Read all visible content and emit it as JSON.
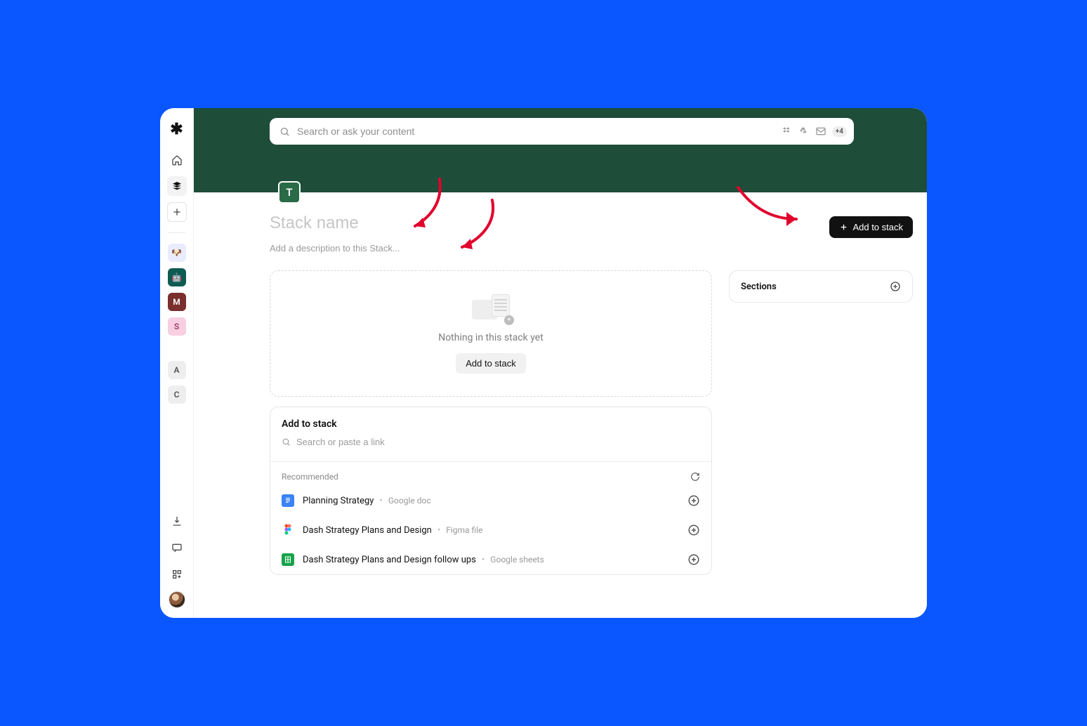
{
  "search": {
    "placeholder": "Search or ask your content",
    "more_count": "+4"
  },
  "sidebar": {
    "logo": "✱",
    "tiles": [
      {
        "label": "🐶"
      },
      {
        "label": "🤖"
      },
      {
        "label": "M"
      },
      {
        "label": "S"
      }
    ],
    "lower_tiles": [
      {
        "label": "A"
      },
      {
        "label": "C"
      }
    ]
  },
  "stack": {
    "avatar_letter": "T",
    "title_placeholder": "Stack name",
    "desc_placeholder": "Add a description to this Stack...",
    "add_button": "Add to stack"
  },
  "empty": {
    "text": "Nothing in this stack yet",
    "button": "Add to stack"
  },
  "add_panel": {
    "title": "Add to stack",
    "search_placeholder": "Search or paste a link",
    "recommended_label": "Recommended",
    "items": [
      {
        "title": "Planning Strategy",
        "type": "Google doc",
        "icon": "gdoc"
      },
      {
        "title": "Dash Strategy Plans and Design",
        "type": "Figma file",
        "icon": "figma"
      },
      {
        "title": "Dash Strategy Plans and Design follow ups",
        "type": "Google sheets",
        "icon": "gsheet"
      }
    ]
  },
  "sections": {
    "title": "Sections"
  }
}
